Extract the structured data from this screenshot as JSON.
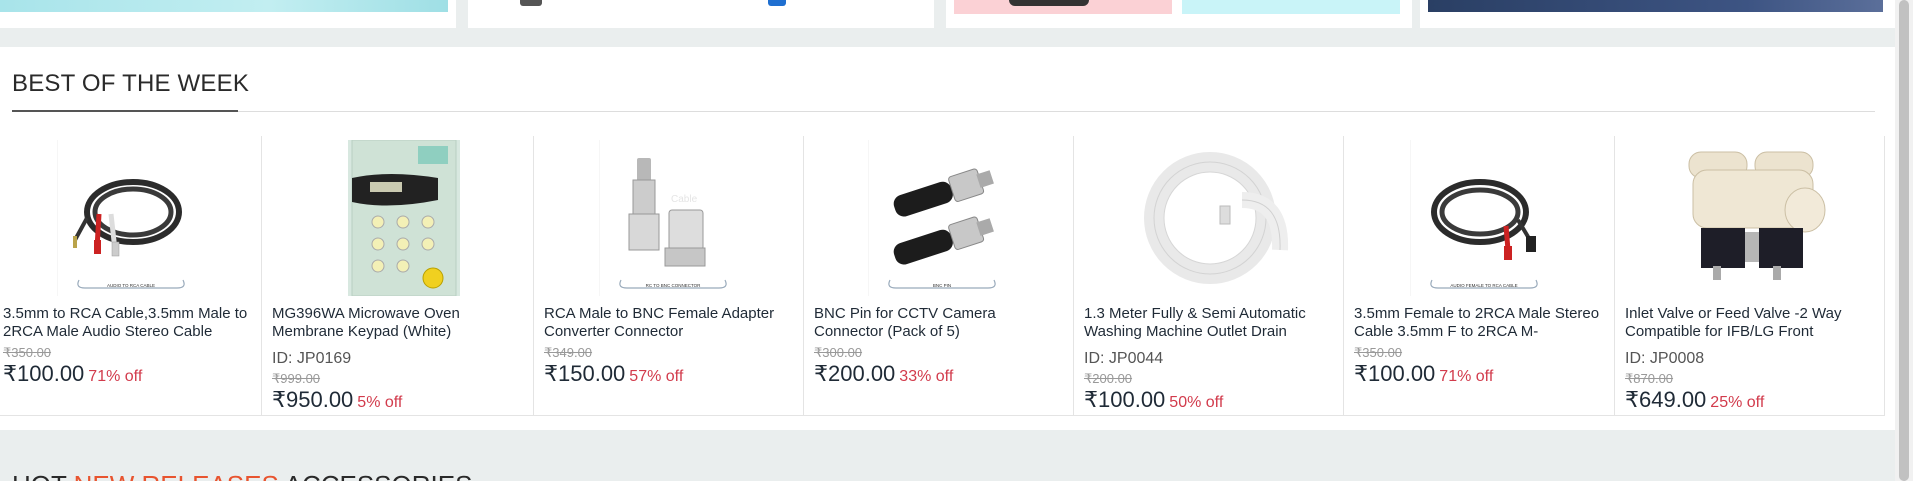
{
  "section": {
    "title": "BEST OF THE WEEK"
  },
  "products": [
    {
      "name": "3.5mm to RCA Cable,3.5mm Male to 2RCA Male Audio Stereo Cable",
      "id_text": "",
      "mrp": "₹350.00",
      "price": "₹100.00",
      "discount": "71% off",
      "image_caption": "AUDIO TO RCA CABLE",
      "image_icon": "audio-rca-cable-icon"
    },
    {
      "name": "MG396WA Microwave Oven Membrane Keypad (White)",
      "id_text": "ID: JP0169",
      "mrp": "₹999.00",
      "price": "₹950.00",
      "discount": "5% off",
      "image_caption": "",
      "image_icon": "microwave-keypad-icon"
    },
    {
      "name": "RCA Male to BNC Female Adapter Converter Connector",
      "id_text": "",
      "mrp": "₹349.00",
      "price": "₹150.00",
      "discount": "57% off",
      "image_caption": "RC TO BNC CONNECTOR",
      "image_icon": "rca-bnc-adapter-icon"
    },
    {
      "name": "BNC Pin for CCTV Camera Connector (Pack of 5)",
      "id_text": "",
      "mrp": "₹300.00",
      "price": "₹200.00",
      "discount": "33% off",
      "image_caption": "BNC PIN",
      "image_icon": "bnc-pin-icon"
    },
    {
      "name": "1.3 Meter Fully & Semi Automatic Washing Machine Outlet Drain",
      "id_text": "ID: JP0044",
      "mrp": "₹200.00",
      "price": "₹100.00",
      "discount": "50% off",
      "image_caption": "",
      "image_icon": "drain-hose-icon"
    },
    {
      "name": "3.5mm Female to 2RCA Male Stereo Cable 3.5mm F to 2RCA M-",
      "id_text": "",
      "mrp": "₹350.00",
      "price": "₹100.00",
      "discount": "71% off",
      "image_caption": "AUDIO FEMALE TO RCA CABLE",
      "image_icon": "audio-female-rca-cable-icon"
    },
    {
      "name": "Inlet Valve or Feed Valve -2 Way Compatible for IFB/LG Front",
      "id_text": "ID: JP0008",
      "mrp": "₹870.00",
      "price": "₹649.00",
      "discount": "25% off",
      "image_caption": "",
      "image_icon": "inlet-valve-icon"
    }
  ],
  "next_section": {
    "title_prefix": "HOT ",
    "title_highlight": "NEW RELEASES",
    "title_suffix": " ACCESSORIES"
  },
  "colors": {
    "discount": "#d23b4c",
    "highlight": "#e8542f"
  }
}
